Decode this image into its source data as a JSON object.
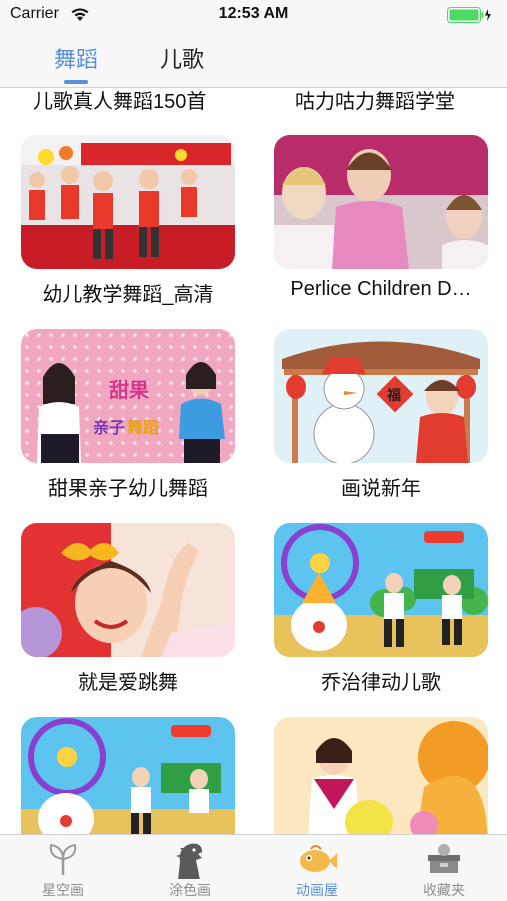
{
  "status_bar": {
    "carrier": "Carrier",
    "time": "12:53 AM"
  },
  "top_tabs": [
    {
      "label": "舞蹈",
      "active": true
    },
    {
      "label": "儿歌",
      "active": false
    }
  ],
  "partial_titles": [
    "儿歌真人舞蹈150首",
    "咕力咕力舞蹈学堂"
  ],
  "grid_items": [
    {
      "title": "幼儿教学舞蹈_高清"
    },
    {
      "title": "Perlice Children D…"
    },
    {
      "title": "甜果亲子幼儿舞蹈",
      "thumb_text_1": "甜果",
      "thumb_text_2": "亲子",
      "thumb_text_3": "舞蹈"
    },
    {
      "title": "画说新年",
      "thumb_text": "福"
    },
    {
      "title": "就是爱跳舞"
    },
    {
      "title": "乔治律动儿歌"
    },
    {
      "title": ""
    },
    {
      "title": ""
    }
  ],
  "bottom_tabs": [
    {
      "label": "星空画",
      "icon": "plant-icon",
      "active": false
    },
    {
      "label": "涂色画",
      "icon": "dinosaur-icon",
      "active": false
    },
    {
      "label": "动画屋",
      "icon": "fish-icon",
      "active": true
    },
    {
      "label": "收藏夹",
      "icon": "box-icon",
      "active": false
    }
  ],
  "colors": {
    "accent": "#5b8fd9",
    "battery": "#4cd964"
  }
}
